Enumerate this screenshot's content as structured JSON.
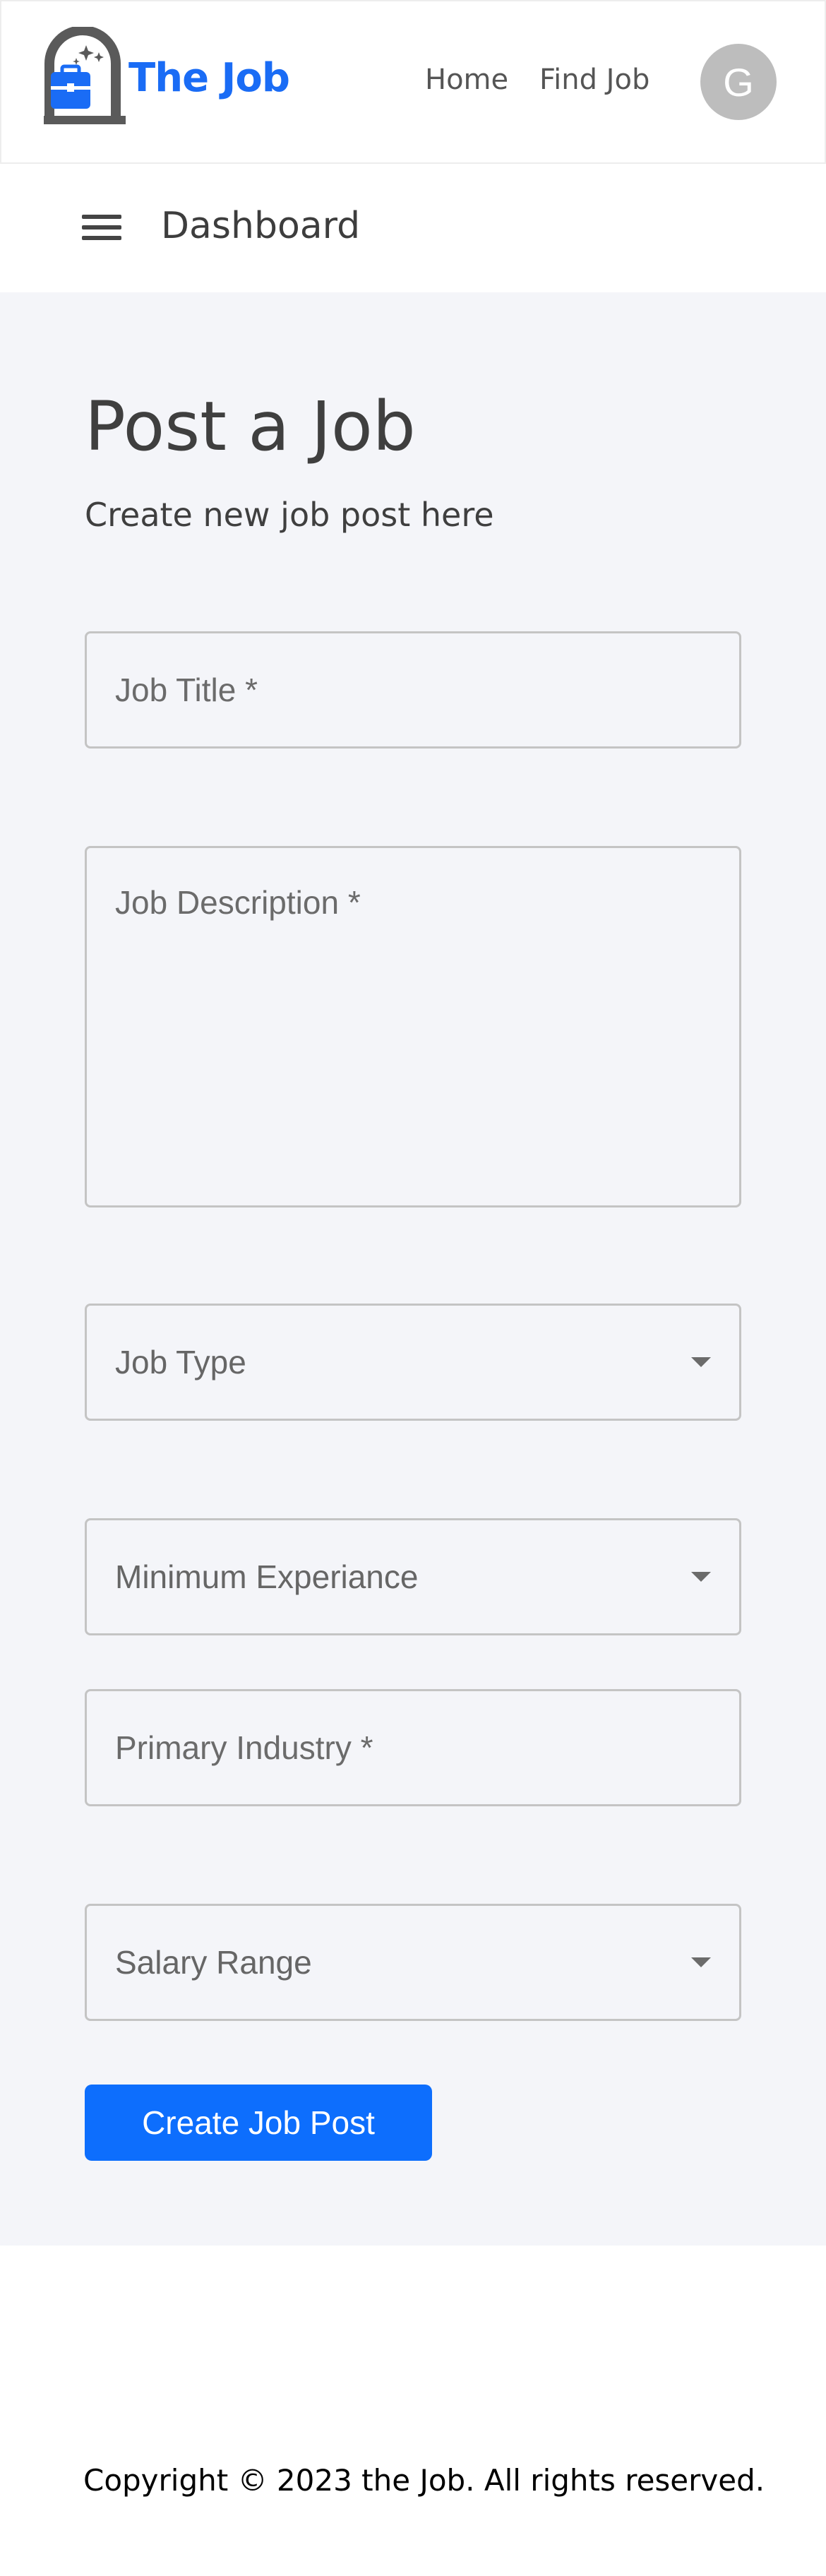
{
  "header": {
    "logo_text": "The Job",
    "nav": {
      "home": "Home",
      "find_job": "Find Job"
    },
    "avatar_initial": "G"
  },
  "subheader": {
    "title": "Dashboard"
  },
  "main": {
    "title": "Post a Job",
    "subtitle": "Create new job post here",
    "fields": {
      "job_title": {
        "placeholder": "Job Title *",
        "value": ""
      },
      "job_description": {
        "placeholder": "Job Description *",
        "value": ""
      },
      "job_type": {
        "label": "Job Type"
      },
      "minimum_experience": {
        "label": "Minimum Experiance"
      },
      "primary_industry": {
        "placeholder": "Primary Industry *",
        "value": ""
      },
      "salary_range": {
        "label": "Salary Range"
      }
    },
    "submit_label": "Create Job Post"
  },
  "footer": {
    "copyright": "Copyright © 2023 the Job. All rights reserved."
  },
  "colors": {
    "brand": "#1a6cf5",
    "primary_button": "#0d6efd",
    "page_background": "#f4f5f9",
    "logo_dark": "#5a5a5a"
  }
}
